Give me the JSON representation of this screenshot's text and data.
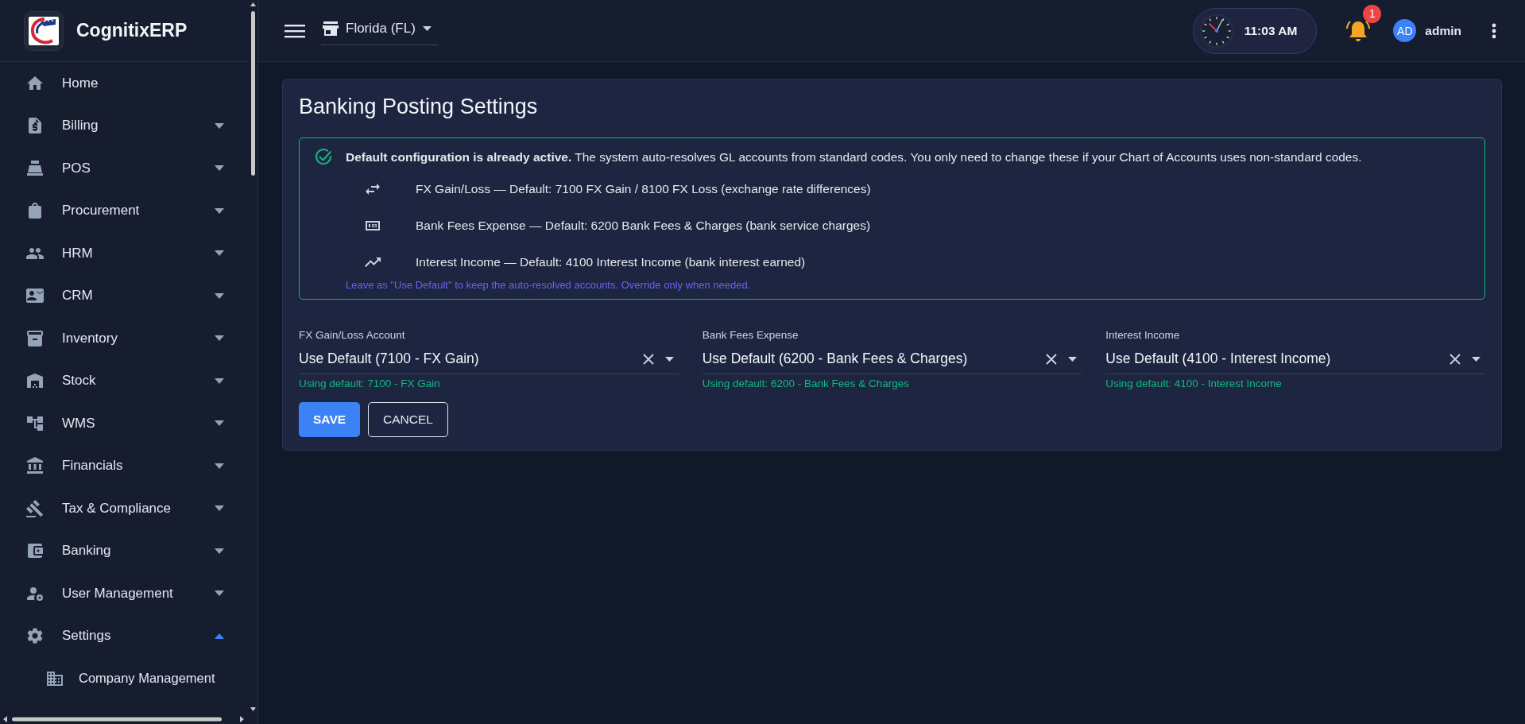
{
  "sidebar": {
    "brand": "CognitixERP",
    "items": [
      {
        "label": "Home"
      },
      {
        "label": "Billing",
        "expanded": false
      },
      {
        "label": "POS",
        "expanded": false
      },
      {
        "label": "Procurement",
        "expanded": false
      },
      {
        "label": "HRM",
        "expanded": false
      },
      {
        "label": "CRM",
        "expanded": false
      },
      {
        "label": "Inventory",
        "expanded": false
      },
      {
        "label": "Stock",
        "expanded": false
      },
      {
        "label": "WMS",
        "expanded": false
      },
      {
        "label": "Financials",
        "expanded": false
      },
      {
        "label": "Tax & Compliance",
        "expanded": false
      },
      {
        "label": "Banking",
        "expanded": false
      },
      {
        "label": "User Management",
        "expanded": false
      },
      {
        "label": "Settings",
        "expanded": true,
        "children": [
          {
            "label": "Company Management"
          }
        ]
      }
    ]
  },
  "topbar": {
    "location": "Florida (FL)",
    "time": "11:03 AM",
    "notification_count": "1",
    "avatar": "AD",
    "user": "admin"
  },
  "card": {
    "title": "Banking Posting Settings",
    "info": {
      "text": "**Default configuration is already active.** The system auto-resolves GL accounts from standard codes. You only need to change these if your Chart of Accounts uses non-standard codes.",
      "rows": [
        "FX Gain/Loss — Default: 7100 FX Gain / 8100 FX Loss (exchange rate differences)",
        "Bank Fees Expense — Default: 6200 Bank Fees & Charges (bank service charges)",
        "Interest Income — Default: 4100 Interest Income (bank interest earned)"
      ],
      "note": "Leave as \"Use Default\" to keep the auto-resolved accounts. Override only when needed."
    },
    "fields": [
      {
        "label": "FX Gain/Loss Account",
        "value": "Use Default (7100 - FX Gain)",
        "helper": "Using default: 7100 - FX Gain"
      },
      {
        "label": "Bank Fees Expense",
        "value": "Use Default (6200 - Bank Fees & Charges)",
        "helper": "Using default: 6200 - Bank Fees & Charges"
      },
      {
        "label": "Interest Income",
        "value": "Use Default (4100 - Interest Income)",
        "helper": "Using default: 4100 - Interest Income"
      }
    ],
    "buttons": [
      {
        "label": "SAVE",
        "kind": "primary"
      },
      {
        "label": "CANCEL",
        "kind": "outlined"
      }
    ]
  }
}
